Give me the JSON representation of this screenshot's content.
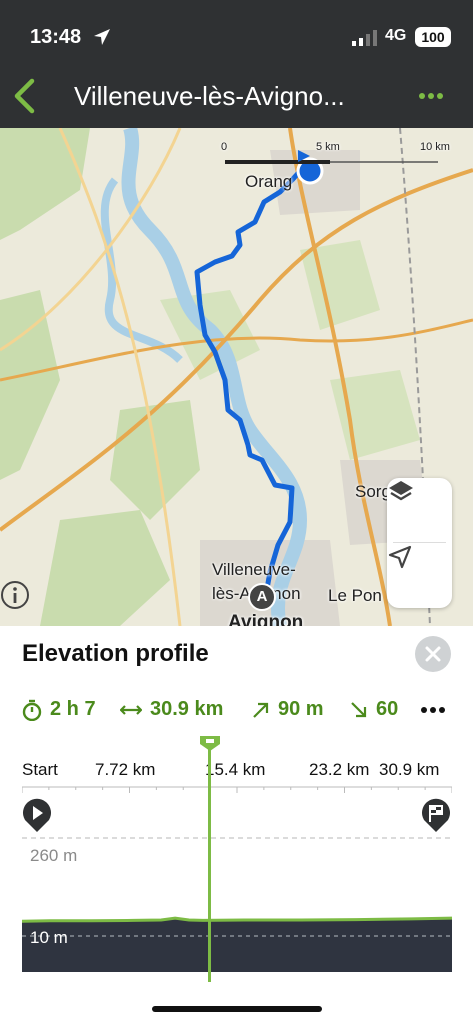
{
  "status_bar": {
    "time": "13:48",
    "network": "4G",
    "battery": "100"
  },
  "nav": {
    "title": "Villeneuve-lès-Avigno..."
  },
  "map": {
    "scale": {
      "zero": "0",
      "mid": "5 km",
      "max": "10 km"
    },
    "labels": {
      "orange": "Orang",
      "sorgues": "Sorg",
      "villeneuve_1": "Villeneuve-",
      "villeneuve_2": "lès-Avignon",
      "le_pontet": "Le Pon",
      "avignon": "Avignon"
    },
    "marker_label": "A",
    "colors": {
      "route": "#1565d8",
      "water": "#a9cfe6",
      "road": "#e6a84e",
      "land": "#eceadb",
      "green": "#c9dcae"
    }
  },
  "sheet": {
    "title": "Elevation profile",
    "stats": {
      "duration": "2 h 7",
      "distance": "30.9 km",
      "ascent": "90 m",
      "descent": "60"
    },
    "axis": {
      "start": "Start",
      "t1": "7.72 km",
      "t2": "15.4 km",
      "t3": "23.2 km",
      "t4": "30.9 km"
    },
    "elevation_labels": {
      "top": "260 m",
      "bottom": "10 m"
    },
    "accent": "#4b8a1c"
  },
  "chart_data": {
    "type": "area",
    "x": [
      0,
      2,
      5,
      8,
      10,
      11,
      12,
      13,
      16,
      20,
      24,
      28,
      30.9
    ],
    "values": [
      12,
      13,
      13,
      14,
      15,
      20,
      15,
      14,
      15,
      15,
      16,
      18,
      20
    ],
    "xlabel": "",
    "ylabel": "",
    "xlim": [
      0,
      30.9
    ],
    "ylim": [
      10,
      260
    ],
    "cursor_km": 13.5
  }
}
